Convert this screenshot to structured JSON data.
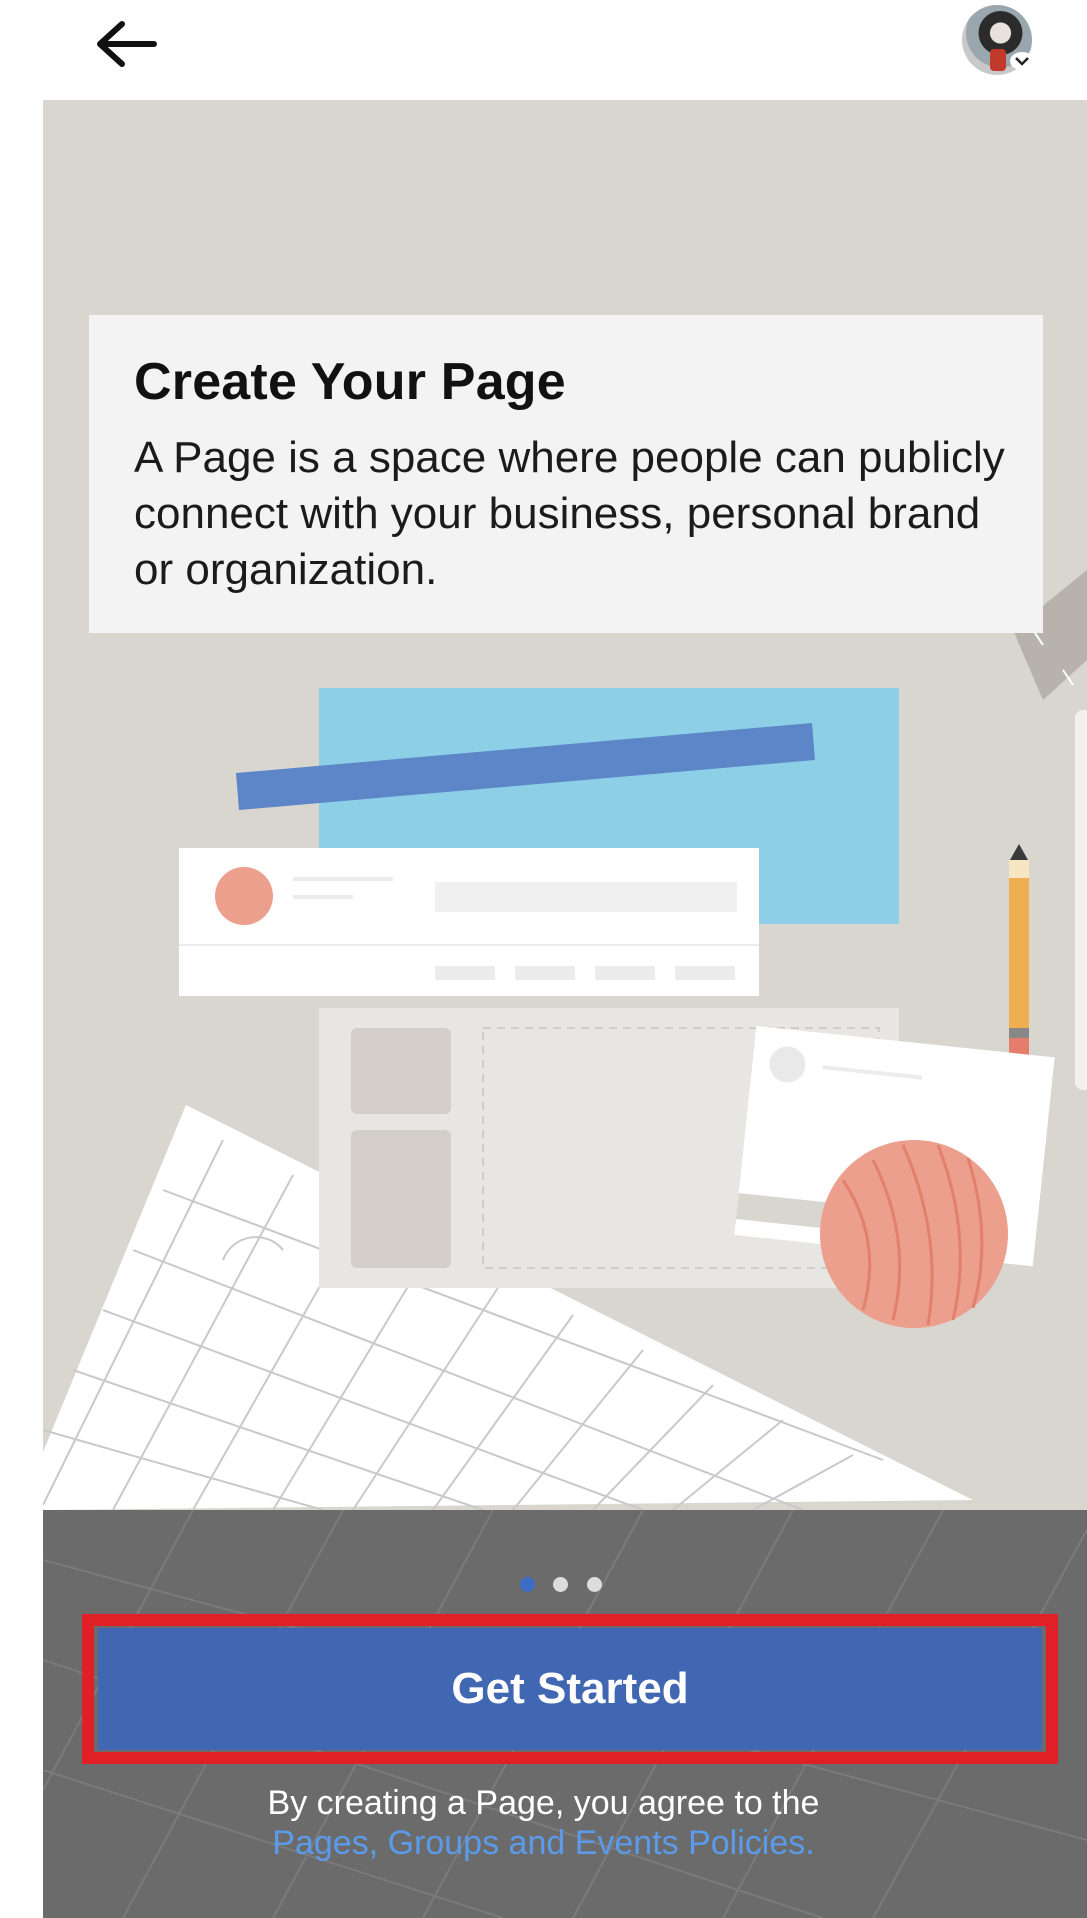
{
  "header": {
    "back_icon": "arrow-left-icon",
    "avatar_icon": "profile-avatar",
    "avatar_caret_icon": "chevron-down-icon"
  },
  "intro": {
    "title": "Create Your Page",
    "body": "A Page is a space where people can publicly connect with your business, personal brand or organization."
  },
  "carousel": {
    "total_steps": 3,
    "active_step": 1
  },
  "actions": {
    "get_started_label": "Get Started"
  },
  "legal": {
    "agree_text": "By creating a Page, you agree to the",
    "policies_link": "Pages, Groups and Events Policies."
  },
  "colors": {
    "primary_button": "#4167b2",
    "highlight_border": "#e01f26",
    "link": "#5b9bea",
    "hero_background": "#d9d5cf"
  }
}
